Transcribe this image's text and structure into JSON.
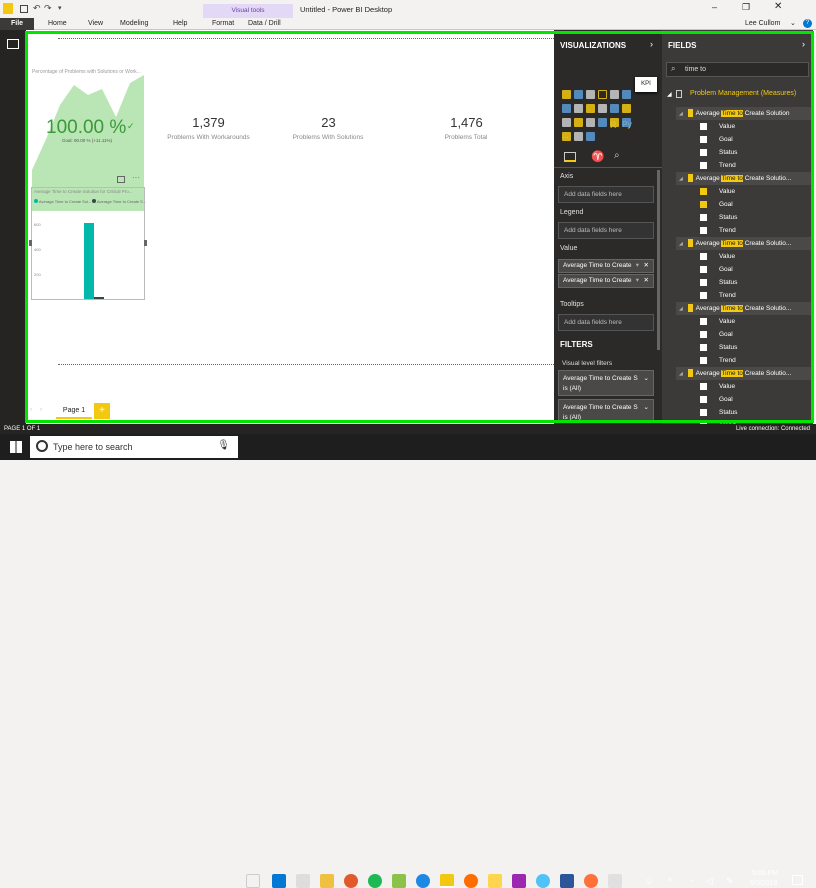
{
  "titlebar": {
    "title": "Untitled - Power BI Desktop",
    "user": "Lee Cullom",
    "visual_tools": "Visual tools"
  },
  "ribbon": {
    "tabs": [
      "File",
      "Home",
      "View",
      "Modeling",
      "Help",
      "Format",
      "Data / Drill"
    ]
  },
  "canvas": {
    "kpi_title": "Percentage of Problems with Solutions or Work...",
    "kpi_value": "100.00 %",
    "kpi_goal": "Goal: 90.00 % (+11.11%)",
    "cards": [
      {
        "value": "1,379",
        "label": "Problems With Workarounds"
      },
      {
        "value": "23",
        "label": "Problems With Solutions"
      },
      {
        "value": "1,476",
        "label": "Problems Total"
      }
    ],
    "bar_title": "Average Time to Create Solution for Critical Pro...",
    "bar_legend": [
      "Average Time to Create Sol...",
      "Average Time to Create S..."
    ],
    "bar_ticks": [
      "600",
      "400",
      "200"
    ],
    "bar_colors": [
      "#01b8aa",
      "#374649"
    ],
    "page_tab": "Page 1",
    "add_page": "+"
  },
  "viz": {
    "header": "VISUALIZATIONS",
    "tooltip": "KPI",
    "python": "Py",
    "r": "R",
    "more": "...",
    "wells": [
      {
        "title": "Axis",
        "placeholder": "Add data fields here"
      },
      {
        "title": "Legend",
        "placeholder": "Add data fields here"
      },
      {
        "title": "Value",
        "fields": [
          "Average Time to Create",
          "Average Time to Create"
        ]
      },
      {
        "title": "Tooltips",
        "placeholder": "Add data fields here"
      }
    ],
    "filters_header": "FILTERS",
    "visual_level": "Visual level filters",
    "filters": [
      "Average Time to Create S",
      "is (All)",
      "Average Time to Create S",
      "is (All)"
    ]
  },
  "fields": {
    "header": "FIELDS",
    "search": "time to",
    "table": "Problem Management (Measures)",
    "measures": [
      {
        "pre": "Average ",
        "hl": "Time to",
        "post": " Create Solution",
        "checked": false
      },
      {
        "pre": "Average ",
        "hl": "Time to",
        "post": " Create Solutio...",
        "checked": true
      },
      {
        "pre": "Average ",
        "hl": "Time to",
        "post": " Create Solutio...",
        "checked": false
      },
      {
        "pre": "Average ",
        "hl": "Time to",
        "post": " Create Solutio...",
        "checked": false
      },
      {
        "pre": "Average ",
        "hl": "Time to",
        "post": " Create Solutio...",
        "checked": false
      }
    ],
    "kpi_parts": [
      "Value",
      "Goal",
      "Status",
      "Trend"
    ]
  },
  "status": {
    "page": "PAGE 1 OF 1",
    "connection": "Live connection: Connected"
  },
  "taskbar": {
    "search": "Type here to search",
    "time": "5:05 PM",
    "date": "6/3/2019"
  }
}
